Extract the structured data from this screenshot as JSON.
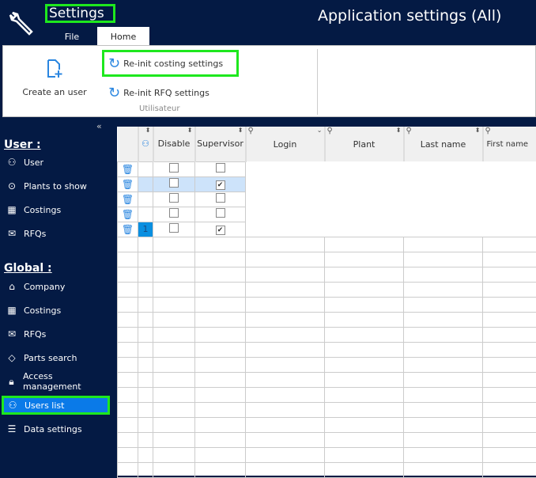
{
  "header": {
    "title": "Settings",
    "app_title": "Application settings (All)",
    "tabs": [
      "File",
      "Home"
    ]
  },
  "ribbon": {
    "create_user": "Create an user",
    "reinit_costing": "Re-init costing settings",
    "reinit_rfq": "Re-init RFQ settings",
    "group_label": "Utilisateur"
  },
  "sidebar": {
    "user_section": "User :",
    "user_items": [
      {
        "label": "User",
        "icon": "user-icon"
      },
      {
        "label": "Plants to show",
        "icon": "pin-icon"
      },
      {
        "label": "Costings",
        "icon": "calculator-icon"
      },
      {
        "label": "RFQs",
        "icon": "rfq-icon"
      }
    ],
    "global_section": "Global :",
    "global_items": [
      {
        "label": "Company",
        "icon": "factory-icon"
      },
      {
        "label": "Costings",
        "icon": "calculator-icon"
      },
      {
        "label": "RFQs",
        "icon": "rfq-icon"
      },
      {
        "label": "Parts search",
        "icon": "tag-icon"
      },
      {
        "label": "Access management",
        "icon": "lock-icon"
      },
      {
        "label": "Users list",
        "icon": "user-icon",
        "selected": true
      },
      {
        "label": "Data settings",
        "icon": "database-icon"
      }
    ]
  },
  "grid": {
    "columns": [
      "Disable",
      "Supervisor",
      "Login",
      "Plant",
      "Last name",
      "First name"
    ],
    "rows": [
      {
        "marker": "",
        "disable": false,
        "supervisor": false
      },
      {
        "marker": "",
        "disable": false,
        "supervisor": true,
        "selected": true
      },
      {
        "marker": "",
        "disable": false,
        "supervisor": false
      },
      {
        "marker": "",
        "disable": false,
        "supervisor": false
      },
      {
        "marker": "1",
        "disable": false,
        "supervisor": true
      }
    ]
  }
}
